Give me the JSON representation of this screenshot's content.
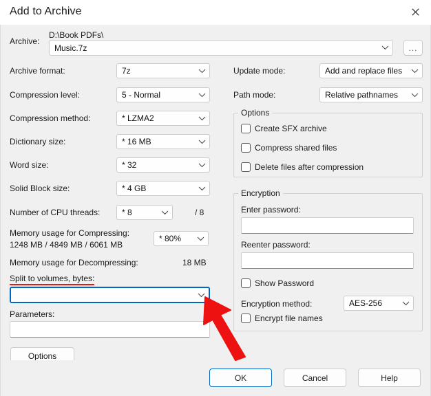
{
  "window": {
    "title": "Add to Archive",
    "close_icon": "close-icon"
  },
  "archive": {
    "label": "Archive:",
    "path": "D:\\Book PDFs\\",
    "value": "Music.7z",
    "browse_label": "..."
  },
  "left_column": {
    "archive_format": {
      "label": "Archive format:",
      "value": "7z"
    },
    "compression_level": {
      "label": "Compression level:",
      "value": "5 - Normal"
    },
    "compression_method": {
      "label": "Compression method:",
      "value": "*  LZMA2"
    },
    "dictionary_size": {
      "label": "Dictionary size:",
      "value": "*  16 MB"
    },
    "word_size": {
      "label": "Word size:",
      "value": "*  32"
    },
    "solid_block_size": {
      "label": "Solid Block size:",
      "value": "*  4 GB"
    },
    "cpu_threads": {
      "label": "Number of CPU threads:",
      "value": "*  8",
      "total": "/ 8"
    },
    "memory_compress": {
      "label": "Memory usage for Compressing:",
      "values": "1248 MB / 4849 MB / 6061 MB",
      "percent": "*  80%"
    },
    "memory_decompress": {
      "label": "Memory usage for Decompressing:",
      "value": "18 MB"
    },
    "split_volumes": {
      "label": "Split to volumes, bytes:",
      "value": ""
    },
    "parameters": {
      "label": "Parameters:",
      "value": ""
    },
    "options_button": "Options"
  },
  "right_column": {
    "update_mode": {
      "label": "Update mode:",
      "value": "Add and replace files"
    },
    "path_mode": {
      "label": "Path mode:",
      "value": "Relative pathnames"
    },
    "options_group": {
      "title": "Options",
      "checkboxes": [
        {
          "label": "Create SFX archive",
          "checked": false
        },
        {
          "label": "Compress shared files",
          "checked": false
        },
        {
          "label": "Delete files after compression",
          "checked": false
        }
      ]
    },
    "encryption_group": {
      "title": "Encryption",
      "enter_password_label": "Enter password:",
      "enter_password_value": "",
      "reenter_password_label": "Reenter password:",
      "reenter_password_value": "",
      "show_password": {
        "label": "Show Password",
        "checked": false
      },
      "encryption_method": {
        "label": "Encryption method:",
        "value": "AES-256"
      },
      "encrypt_file_names": {
        "label": "Encrypt file names",
        "checked": false
      }
    }
  },
  "footer": {
    "ok": "OK",
    "cancel": "Cancel",
    "help": "Help"
  },
  "annotation": {
    "arrow_color": "#ee1111",
    "underline_color": "#e01b1b"
  },
  "colors": {
    "accent": "#0067c0",
    "dialog_bg": "#f0f0f0",
    "titlebar_bg": "#ffffff"
  }
}
